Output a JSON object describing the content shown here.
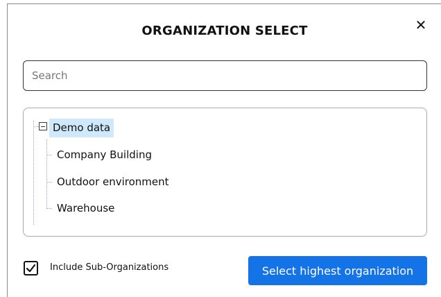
{
  "dialog": {
    "title": "ORGANIZATION SELECT",
    "close_icon": "close-icon",
    "search": {
      "placeholder": "Search",
      "value": ""
    },
    "tree": {
      "root": {
        "label": "Demo data",
        "expanded": true,
        "selected": true,
        "toggle_icon": "minus-square-icon"
      },
      "children": [
        {
          "label": "Company Building"
        },
        {
          "label": "Outdoor environment"
        },
        {
          "label": "Warehouse"
        }
      ]
    },
    "footer": {
      "include_sub": {
        "label": "Include Sub-Organizations",
        "checked": true,
        "icon": "checkmark-icon"
      },
      "primary_button": "Select highest organization"
    }
  },
  "colors": {
    "primary": "#1473e6",
    "selection": "#cfe8fb",
    "border": "#a8a8a8"
  }
}
